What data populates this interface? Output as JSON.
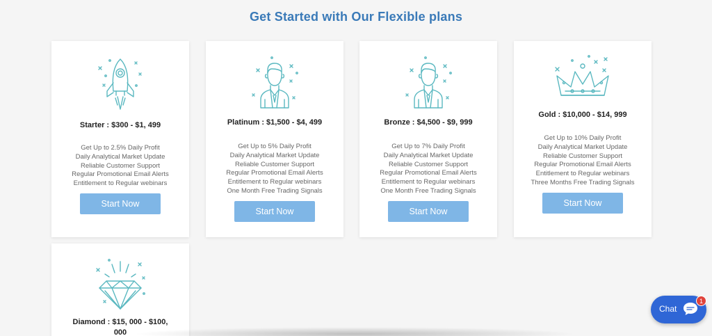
{
  "header": {
    "title": "Get Started with Our Flexible plans"
  },
  "icon_color": "#5ab8c0",
  "button_color": "#7fb6e6",
  "plans": [
    {
      "icon": "rocket-icon",
      "title": "Starter : $300 - $1, 499",
      "features": [
        "Get Up to 2.5% Daily Profit",
        "Daily Analytical Market Update",
        "Reliable Customer Support",
        "Regular Promotional Email Alerts",
        "Entitlement to Regular webinars"
      ],
      "button": "Start Now"
    },
    {
      "icon": "businessman-icon",
      "title": "Platinum : $1,500 - $4, 499",
      "features": [
        "Get Up to 5% Daily Profit",
        "Daily Analytical Market Update",
        "Reliable Customer Support",
        "Regular Promotional Email Alerts",
        "Entitlement to Regular webinars",
        "One Month Free Trading Signals"
      ],
      "button": "Start Now"
    },
    {
      "icon": "businessman-icon",
      "title": "Bronze : $4,500 - $9, 999",
      "features": [
        "Get Up to 7% Daily Profit",
        "Daily Analytical Market Update",
        "Reliable Customer Support",
        "Regular Promotional Email Alerts",
        "Entitlement to Regular webinars",
        "One Month Free Trading Signals"
      ],
      "button": "Start Now"
    },
    {
      "icon": "crown-icon",
      "title": "Gold : $10,000 - $14, 999",
      "features": [
        "Get Up to 10% Daily Profit",
        "Daily Analytical Market Update",
        "Reliable Customer Support",
        "Regular Promotional Email Alerts",
        "Entitlement to Regular webinars",
        "Three Months Free Trading Signals"
      ],
      "button": "Start Now"
    },
    {
      "icon": "diamond-icon",
      "title_line1": "Diamond : $15, 000 - $100,",
      "title_line2": "000"
    }
  ],
  "chat": {
    "label": "Chat",
    "badge": "1",
    "icon": "chat-bubble-icon"
  }
}
